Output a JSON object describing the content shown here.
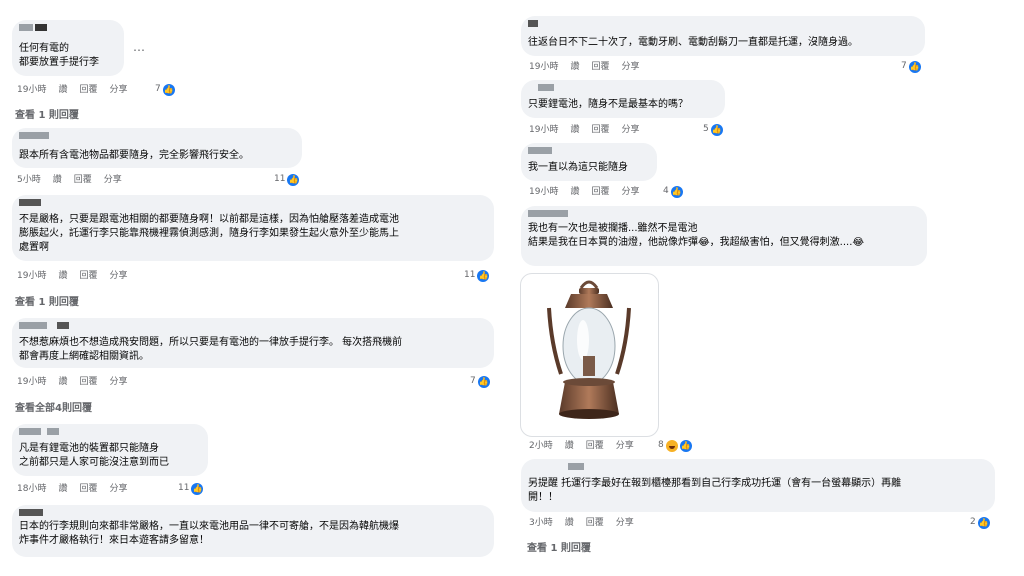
{
  "left_comments": [
    {
      "text": "任何有電的\n都要放置手提行李",
      "time": "19小時",
      "like": "讚",
      "reply": "回覆",
      "share": "分享",
      "count": "7",
      "replies": "查看 1 則回覆"
    },
    {
      "text": "跟本所有含電池物品都要隨身，完全影響飛行安全。",
      "time": "5小時",
      "like": "讚",
      "reply": "回覆",
      "share": "分享",
      "count": "11"
    },
    {
      "text": "不是嚴格，只要是跟電池相關的都要隨身啊！以前都是這樣，因為怕艙壓落差造成電池\n膨脹起火，託運行李只能靠飛機裡霧偵測感測，隨身行李如果發生起火意外至少能馬上\n處置啊",
      "time": "19小時",
      "like": "讚",
      "reply": "回覆",
      "share": "分享",
      "count": "11",
      "replies": "查看 1 則回覆"
    },
    {
      "text": "不想惹麻煩也不想造成飛安問題，所以只要是有電池的一律放手提行李。 每次搭飛機前\n都會再度上網確認相關資訊。",
      "time": "19小時",
      "like": "讚",
      "reply": "回覆",
      "share": "分享",
      "count": "7",
      "replies": "查看全部4則回覆"
    },
    {
      "text": "凡是有鋰電池的裝置都只能隨身\n之前都只是人家可能沒注意到而已",
      "time": "18小時",
      "like": "讚",
      "reply": "回覆",
      "share": "分享",
      "count": "11"
    },
    {
      "text": "日本的行李規則向來都非常嚴格，一直以來電池用品一律不可寄艙，不是因為韓航機爆\n炸事件才嚴格執行！來日本遊客請多留意！"
    }
  ],
  "right_comments": [
    {
      "text": "往返台日不下二十次了，電動牙刷、電動刮鬍刀一直都是托運，沒隨身過。",
      "time": "19小時",
      "like": "讚",
      "reply": "回覆",
      "share": "分享",
      "count": "7"
    },
    {
      "text": "只要鋰電池，隨身不是最基本的嗎？",
      "time": "19小時",
      "like": "讚",
      "reply": "回覆",
      "share": "分享",
      "count": "5"
    },
    {
      "text": "我一直以為這只能隨身",
      "time": "19小時",
      "like": "讚",
      "reply": "回覆",
      "share": "分享",
      "count": "4"
    },
    {
      "text": "我也有一次也是被攔播...雖然不是電池\n結果是我在日本買的油燈，他說像炸彈😂，我超級害怕，但又覺得刺激....😂",
      "time": "2小時",
      "like": "讚",
      "reply": "回覆",
      "share": "分享",
      "count": "8"
    },
    {
      "text": "另提醒 托運行李最好在報到櫃檯那看到自己行李成功托運（會有一台螢幕顯示）再離\n開！！",
      "time": "3小時",
      "like": "讚",
      "reply": "回覆",
      "share": "分享",
      "count": "2",
      "replies": "查看 1 則回覆"
    }
  ],
  "more_options": "…",
  "icons": {
    "like": "like-icon",
    "haha": "haha-icon",
    "photo": "oil-lantern-photo"
  },
  "colors": {
    "bubble": "#f0f2f5",
    "like_blue": "#1877f2",
    "meta_gray": "#65676b"
  }
}
